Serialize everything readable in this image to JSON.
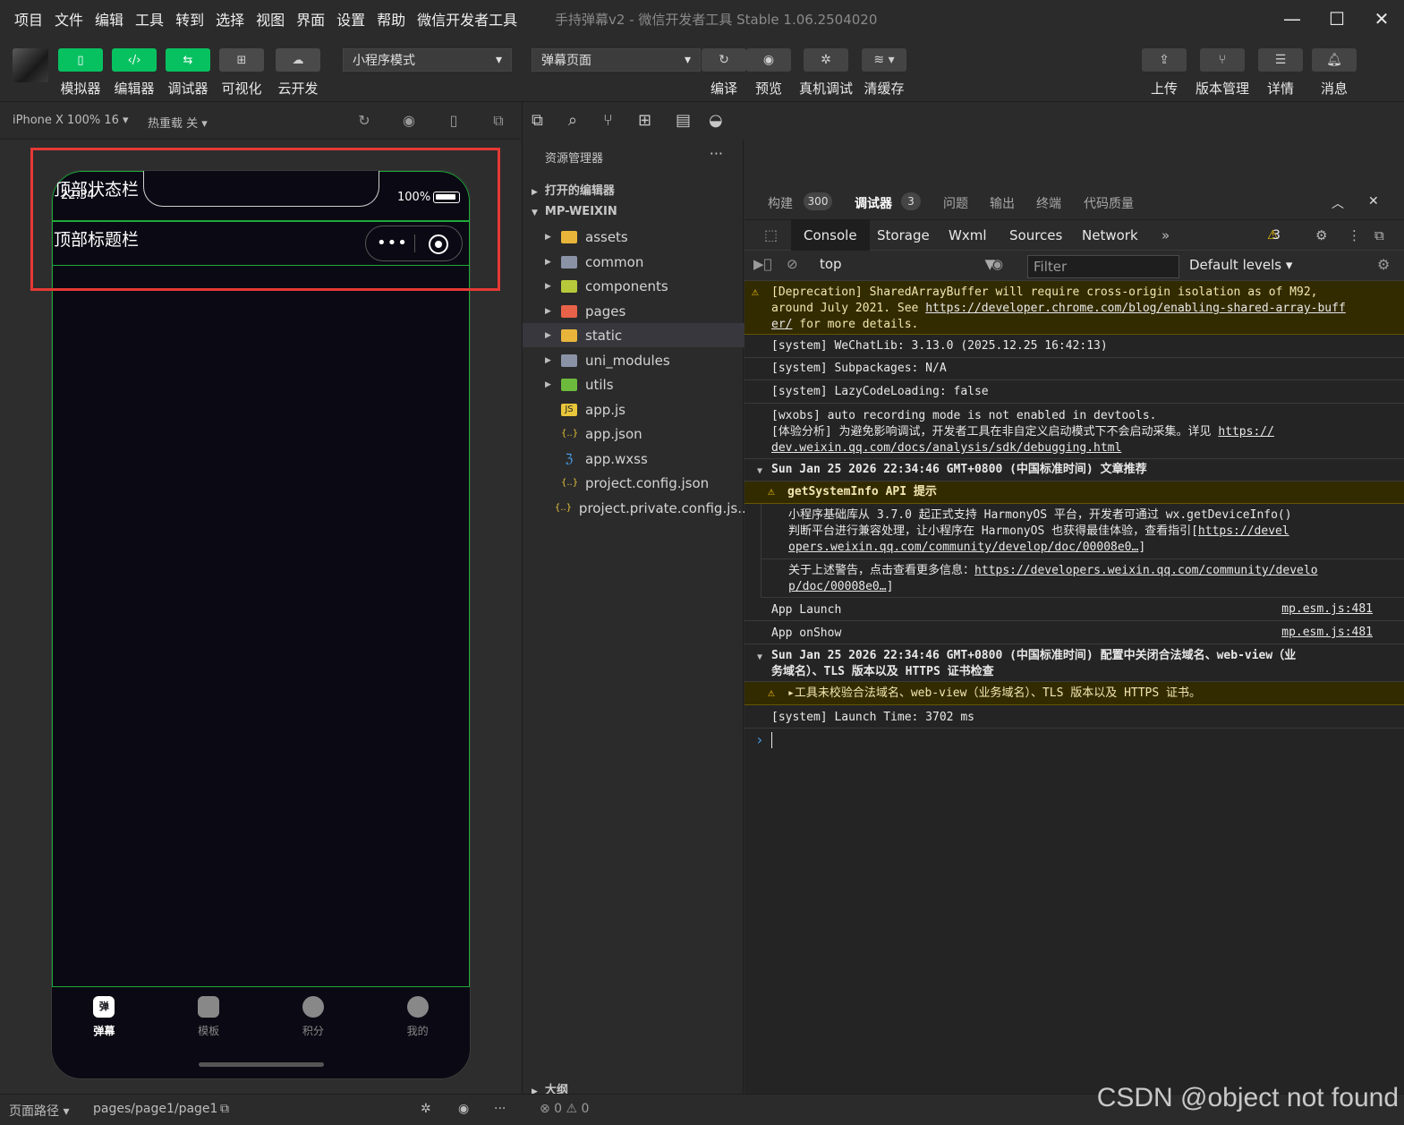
{
  "menu": [
    "项目",
    "文件",
    "编辑",
    "工具",
    "转到",
    "选择",
    "视图",
    "界面",
    "设置",
    "帮助",
    "微信开发者工具"
  ],
  "window_title": "手持弹幕v2 - 微信开发者工具 Stable 1.06.2504020",
  "toolbar": {
    "left_buttons": [
      "模拟器",
      "编辑器",
      "调试器",
      "可视化",
      "云开发"
    ],
    "mode_select": "小程序模式",
    "page_select": "弹幕页面",
    "mid_buttons": [
      "编译",
      "预览",
      "真机调试",
      "清缓存"
    ],
    "right_buttons": [
      "上传",
      "版本管理",
      "详情",
      "消息"
    ]
  },
  "simbar": {
    "device": "iPhone X 100% 16 ▾",
    "hot_reload": "热重载 关 ▾"
  },
  "phone": {
    "status_label": "顶部状态栏",
    "time": "22:34",
    "battery": "100%",
    "title_label": "顶部标题栏",
    "tabs": [
      {
        "label": "弹幕",
        "icon_text": "弹",
        "active": true
      },
      {
        "label": "模板",
        "icon_text": "",
        "active": false
      },
      {
        "label": "积分",
        "icon_text": "",
        "active": false
      },
      {
        "label": "我的",
        "icon_text": "",
        "active": false
      }
    ]
  },
  "explorer": {
    "header": "资源管理器",
    "open_editors": "打开的编辑器",
    "project": "MP-WEIXIN",
    "items": [
      {
        "name": "assets",
        "type": "folder",
        "color": "#e8b53a"
      },
      {
        "name": "common",
        "type": "folder",
        "color": "#8a93a6"
      },
      {
        "name": "components",
        "type": "folder",
        "color": "#b7c93a"
      },
      {
        "name": "pages",
        "type": "folder",
        "color": "#e8624a"
      },
      {
        "name": "static",
        "type": "folder",
        "color": "#e8b53a"
      },
      {
        "name": "uni_modules",
        "type": "folder",
        "color": "#8a93a6"
      },
      {
        "name": "utils",
        "type": "folder",
        "color": "#6dbb3c"
      },
      {
        "name": "app.js",
        "type": "file",
        "icon": "JS",
        "color": "#e8c53a"
      },
      {
        "name": "app.json",
        "type": "file",
        "icon": "{..}",
        "color": "#e8c53a"
      },
      {
        "name": "app.wxss",
        "type": "file",
        "icon": "ℨ",
        "color": "#4a9be8"
      },
      {
        "name": "project.config.json",
        "type": "file",
        "icon": "{..}",
        "color": "#e8c53a"
      },
      {
        "name": "project.private.config.js...",
        "type": "file",
        "icon": "{..}",
        "color": "#e8c53a"
      }
    ],
    "outline": "大纲"
  },
  "devtools": {
    "top_tabs": [
      {
        "label": "构建",
        "badge": "300"
      },
      {
        "label": "调试器",
        "badge": "3"
      },
      {
        "label": "问题"
      },
      {
        "label": "输出"
      },
      {
        "label": "终端"
      },
      {
        "label": "代码质量"
      }
    ],
    "panel_tabs": [
      "Console",
      "Storage",
      "Wxml",
      "Sources",
      "Network"
    ],
    "warning_count": "3",
    "context": "top",
    "filter_placeholder": "Filter",
    "levels": "Default levels",
    "logs": {
      "deprecation_1": "[Deprecation] SharedArrayBuffer will require cross-origin isolation as of M92,",
      "deprecation_2": "around July 2021. See ",
      "deprecation_link1": "https://developer.chrome.com/blog/enabling-shared-array-buff",
      "deprecation_link2": "er/",
      "deprecation_3": " for more details.",
      "wechatlib": "[system] WeChatLib: 3.13.0 (2025.12.25 16:42:13)",
      "subpackages": "[system] Subpackages: N/A",
      "lazy": "[system] LazyCodeLoading: false",
      "wxobs_1": "[wxobs] auto recording mode is not enabled in devtools.",
      "wxobs_2": "[体验分析] 为避免影响调试，开发者工具在非自定义启动模式下不会启动采集。详见 ",
      "wxobs_link1": "https://",
      "wxobs_link2": "dev.weixin.qq.com/docs/analysis/sdk/debugging.html",
      "group1": "Sun Jan 25 2026 22:34:46 GMT+0800 (中国标准时间) 文章推荐",
      "sysinfo_title": "getSystemInfo API 提示",
      "sysinfo_1": "小程序基础库从 3.7.0 起正式支持 HarmonyOS 平台，开发者可通过 wx.getDeviceInfo()",
      "sysinfo_2": "判断平台进行兼容处理，让小程序在 HarmonyOS 也获得最佳体验，查看指引[",
      "sysinfo_link1": "https://devel",
      "sysinfo_link2": "opers.weixin.qq.com/community/develop/doc/00008e0…",
      "sysinfo_end": "]",
      "more_1": "关于上述警告，点击查看更多信息：",
      "more_link1": "https://developers.weixin.qq.com/community/develo",
      "more_link2": "p/doc/00008e0…",
      "more_end": "]",
      "launch": "App Launch",
      "onshow": "App onShow",
      "src": "mp.esm.js:481",
      "group2_1": "Sun Jan 25 2026 22:34:46 GMT+0800 (中国标准时间) 配置中关闭合法域名、web-view（业",
      "group2_2": "务域名）、TLS 版本以及 HTTPS 证书检查",
      "tls_warn": "▸工具未校验合法域名、web-view（业务域名）、TLS 版本以及 HTTPS 证书。",
      "launch_time": "[system] Launch Time: 3702 ms",
      "prompt": "›"
    }
  },
  "bottombar": {
    "path_label": "页面路径 ▾",
    "path": "pages/page1/page1",
    "errors": "⊗ 0 ⚠ 0"
  },
  "watermark": "CSDN @object not found"
}
